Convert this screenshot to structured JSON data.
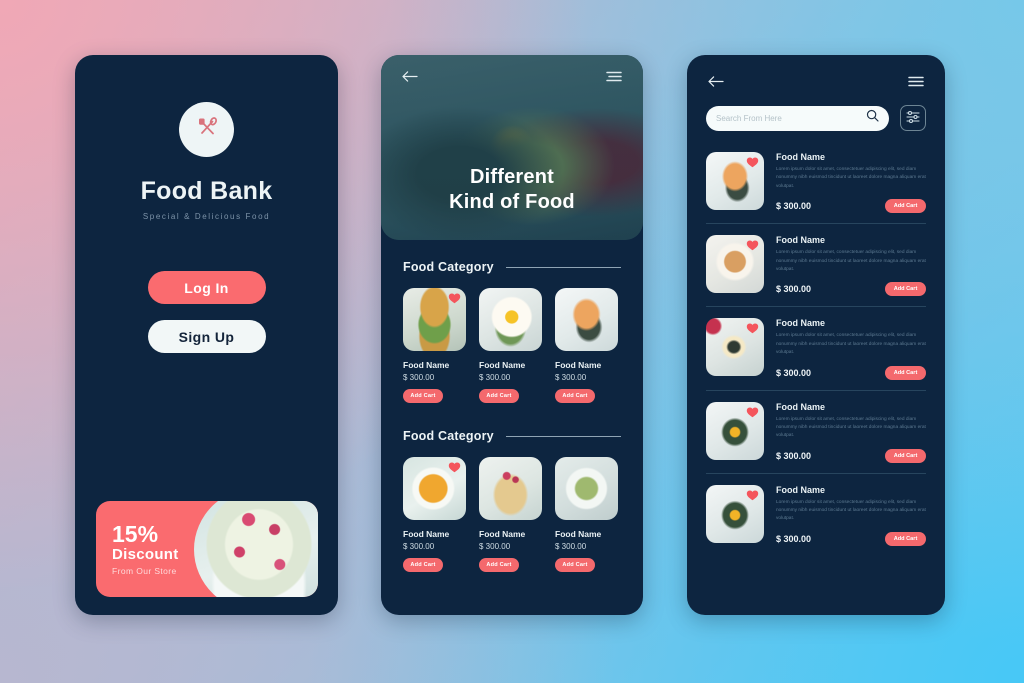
{
  "theme": {
    "panel_bg": "#0d2540",
    "accent": "#fa6b6f",
    "text_light": "#edf4f6",
    "muted": "#7d93a8"
  },
  "screen1": {
    "name": "login-screen",
    "logo_icon": "spoon-spatula-icon",
    "brand_title": "Food Bank",
    "brand_subtitle": "Special & Delicious Food",
    "login_label": "Log In",
    "signup_label": "Sign Up",
    "promo": {
      "percent": "15%",
      "discount_label": "Discount",
      "store_label": "From Our Store",
      "image": "pancake-stack-photo"
    }
  },
  "screen2": {
    "name": "category-screen",
    "back_icon": "arrow-left-icon",
    "menu_icon": "hamburger-menu-icon",
    "hero_title_line1": "Different",
    "hero_title_line2": "Kind of Food",
    "hero_image": "cake-and-tea-photo",
    "sections": [
      {
        "title": "Food Category",
        "cards": [
          {
            "name": "Food Name",
            "price": "$ 300.00",
            "add_label": "Add Cart",
            "favorite": true,
            "image": "burger-photo"
          },
          {
            "name": "Food Name",
            "price": "$ 300.00",
            "add_label": "Add Cart",
            "favorite": false,
            "image": "fried-egg-toast-photo"
          },
          {
            "name": "Food Name",
            "price": "$ 300.00",
            "add_label": "Add Cart",
            "favorite": false,
            "image": "peach-toast-photo"
          }
        ]
      },
      {
        "title": "Food Category",
        "cards": [
          {
            "name": "Food Name",
            "price": "$ 300.00",
            "add_label": "Add Cart",
            "favorite": true,
            "image": "pumpkin-soup-photo"
          },
          {
            "name": "Food Name",
            "price": "$ 300.00",
            "add_label": "Add Cart",
            "favorite": false,
            "image": "berry-pancake-photo"
          },
          {
            "name": "Food Name",
            "price": "$ 300.00",
            "add_label": "Add Cart",
            "favorite": false,
            "image": "pasta-photo"
          }
        ]
      }
    ]
  },
  "screen3": {
    "name": "search-list-screen",
    "back_icon": "arrow-left-icon",
    "menu_icon": "hamburger-menu-icon",
    "search": {
      "placeholder": "Search From Here",
      "value": "",
      "icon": "search-icon"
    },
    "filter_icon": "sliders-filter-icon",
    "items": [
      {
        "name": "Food Name",
        "description": "Lorem ipsum dolor sit amet, consectetuer adipiscing elit, sed diam nonummy nibh euismod tincidunt ut laoreet dolore magna aliquam erat volutpat.",
        "price": "$ 300.00",
        "add_label": "Add Cart",
        "favorite": true,
        "image": "peach-toast-photo"
      },
      {
        "name": "Food Name",
        "description": "Lorem ipsum dolor sit amet, consectetuer adipiscing elit, sed diam nonummy nibh euismod tincidunt ut laoreet dolore magna aliquam erat volutpat.",
        "price": "$ 300.00",
        "add_label": "Add Cart",
        "favorite": true,
        "image": "bagel-photo"
      },
      {
        "name": "Food Name",
        "description": "Lorem ipsum dolor sit amet, consectetuer adipiscing elit, sed diam nonummy nibh euismod tincidunt ut laoreet dolore magna aliquam erat volutpat.",
        "price": "$ 300.00",
        "add_label": "Add Cart",
        "favorite": true,
        "image": "sandwich-plate-photo"
      },
      {
        "name": "Food Name",
        "description": "Lorem ipsum dolor sit amet, consectetuer adipiscing elit, sed diam nonummy nibh euismod tincidunt ut laoreet dolore magna aliquam erat volutpat.",
        "price": "$ 300.00",
        "add_label": "Add Cart",
        "favorite": true,
        "image": "avocado-egg-toast-photo"
      },
      {
        "name": "Food Name",
        "description": "Lorem ipsum dolor sit amet, consectetuer adipiscing elit, sed diam nonummy nibh euismod tincidunt ut laoreet dolore magna aliquam erat volutpat.",
        "price": "$ 300.00",
        "add_label": "Add Cart",
        "favorite": true,
        "image": "avocado-egg-toast-photo"
      }
    ]
  }
}
